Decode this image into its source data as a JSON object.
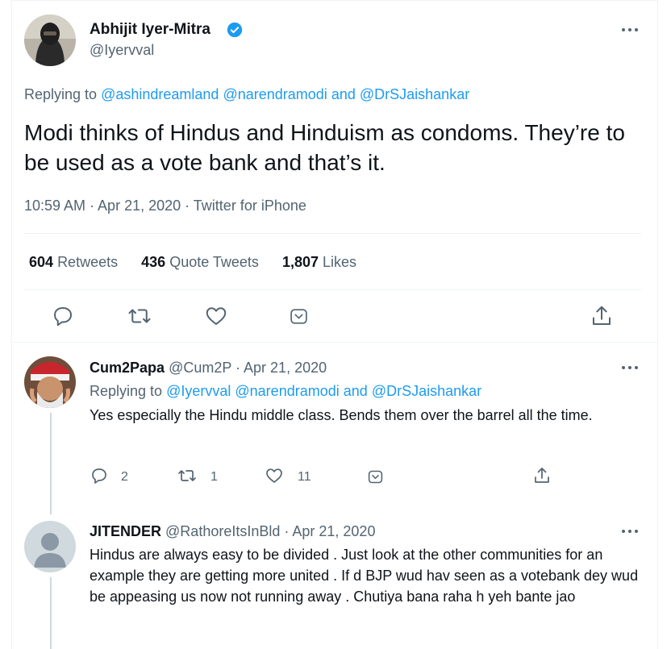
{
  "main_tweet": {
    "author_name": "Abhijit Iyer-Mitra",
    "author_handle": "@Iyervval",
    "replying_prefix": "Replying to",
    "reply_mentions": [
      "@ashindreamland",
      "@narendramodi",
      "@DrSJaishankar"
    ],
    "and_word": "and",
    "text": "Modi thinks of Hindus and Hinduism as condoms. They’re to be used as a vote bank and that’s it.",
    "timestamp": "10:59 AM · Apr 21, 2020 · Twitter for iPhone",
    "stats": {
      "retweets_count": "604",
      "retweets_label": "Retweets",
      "quotes_count": "436",
      "quotes_label": "Quote Tweets",
      "likes_count": "1,807",
      "likes_label": "Likes"
    }
  },
  "replies": [
    {
      "name": "Cum2Papa",
      "handle_date": "@Cum2P · Apr 21, 2020",
      "replying_prefix": "Replying to",
      "mentions": [
        "@Iyervval",
        "@narendramodi",
        "@DrSJaishankar"
      ],
      "and_word": "and",
      "text": "Yes especially the Hindu middle class. Bends them over the barrel all the time.",
      "reply_count": "2",
      "retweet_count": "1",
      "like_count": "11"
    },
    {
      "name": "JITENDER",
      "handle_date": "@RathoreItsInBld · Apr 21, 2020",
      "text": "Hindus are always easy to be divided . Just  look at the other communities for an example they are getting more united . If d BJP wud hav seen as a votebank dey wud be appeasing us now not running away . Chutiya bana raha h yeh bante jao"
    }
  ],
  "colors": {
    "link": "#1d9bf0",
    "secondary_text": "#536471",
    "primary_text": "#0f1419",
    "divider": "#eff3f4"
  },
  "icons": [
    "reply-icon",
    "retweet-icon",
    "like-icon",
    "save-icon",
    "share-icon",
    "more-icon",
    "verified-icon"
  ]
}
